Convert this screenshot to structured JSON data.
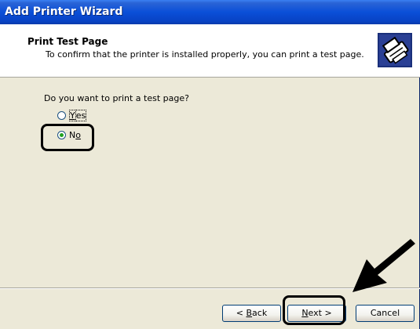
{
  "window": {
    "title": "Add Printer Wizard"
  },
  "header": {
    "title": "Print Test Page",
    "subtitle": "To confirm that the printer is installed properly, you can print a test page."
  },
  "content": {
    "question": "Do you want to print a test page?",
    "options": [
      {
        "label_prefix": "",
        "label_accel": "Y",
        "label_suffix": "es",
        "selected": false
      },
      {
        "label_prefix": "N",
        "label_accel": "o",
        "label_suffix": "",
        "selected": true
      }
    ]
  },
  "buttons": {
    "back": {
      "prefix": "< ",
      "accel": "B",
      "suffix": "ack"
    },
    "next": {
      "prefix": "",
      "accel": "N",
      "suffix": "ext >"
    },
    "cancel": "Cancel"
  },
  "icons": {
    "header_icon": "printer-icon",
    "annotation": "pointer-arrow-icon"
  },
  "colors": {
    "titlebar": "#0a4fd8",
    "dialog": "#ece9d8",
    "radio_dot": "#21a121"
  }
}
